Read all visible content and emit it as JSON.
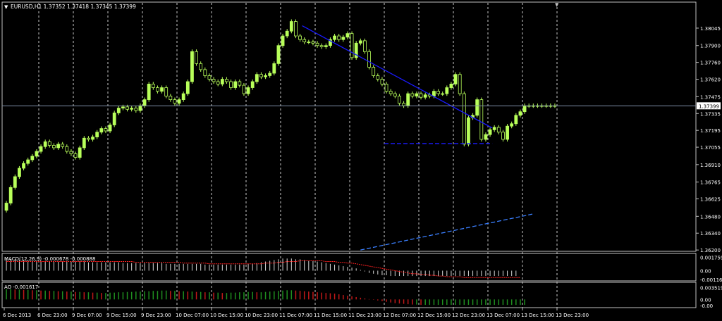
{
  "colors": {
    "background": "#000000",
    "frame": "#c0c0c0",
    "grid": "#c8c8c8",
    "text": "#ffffff",
    "candle_bull": "#b8ff5a",
    "candle_bear": "#000000",
    "candle_wick": "#b8ff5a",
    "trendline": "#1a1aff",
    "support": "#1a1aff",
    "channel": "#3a7fff",
    "bid_line": "#8090a8",
    "macd_hist": "#d8d8d8",
    "macd_signal": "#ff2020",
    "ao_up": "#1f8f1f",
    "ao_down": "#c01818"
  },
  "chart_data": [
    {
      "type": "candlestick",
      "title": "EURUSD,H1  1.37352 1.37418 1.37345 1.37399",
      "symbol_menu_icon": "triangle-down-icon",
      "ylim": [
        1.36195,
        1.38115
      ],
      "y_ticks": [
        "1.38045",
        "1.37900",
        "1.37760",
        "1.37620",
        "1.37475",
        "1.37335",
        "1.37195",
        "1.37055",
        "1.36910",
        "1.36765",
        "1.36625",
        "1.36480",
        "1.36340",
        "1.36200"
      ],
      "current_price_label": "1.37399",
      "current_price": 1.37399,
      "x_ticks": [
        "6 Dec 2013",
        "6 Dec 23:00",
        "9 Dec 07:00",
        "9 Dec 15:00",
        "9 Dec 23:00",
        "10 Dec 07:00",
        "10 Dec 15:00",
        "10 Dec 23:00",
        "11 Dec 07:00",
        "11 Dec 15:00",
        "11 Dec 23:00",
        "12 Dec 07:00",
        "12 Dec 15:00",
        "12 Dec 23:00",
        "13 Dec 07:00",
        "13 Dec 15:00",
        "13 Dec 23:00"
      ],
      "grid_x_ticks": [
        1,
        2,
        3,
        4,
        5,
        6,
        7,
        8,
        9,
        10,
        11,
        12,
        13,
        14,
        15,
        16
      ],
      "bars_per_tick": 8,
      "bar_count": 128,
      "close": [
        1.3659,
        1.3672,
        1.3681,
        1.3688,
        1.3692,
        1.3695,
        1.3698,
        1.3702,
        1.3706,
        1.371,
        1.3707,
        1.3705,
        1.3708,
        1.3706,
        1.3702,
        1.37,
        1.3697,
        1.3705,
        1.3713,
        1.3712,
        1.3714,
        1.3718,
        1.3721,
        1.3719,
        1.3724,
        1.3734,
        1.3738,
        1.3739,
        1.3737,
        1.3738,
        1.3736,
        1.374,
        1.3745,
        1.3758,
        1.3755,
        1.3752,
        1.3755,
        1.3748,
        1.3745,
        1.3742,
        1.3745,
        1.375,
        1.376,
        1.3785,
        1.3775,
        1.377,
        1.3765,
        1.3762,
        1.376,
        1.3758,
        1.3762,
        1.376,
        1.3755,
        1.376,
        1.3757,
        1.375,
        1.3755,
        1.376,
        1.3766,
        1.3764,
        1.3765,
        1.3767,
        1.3775,
        1.379,
        1.3798,
        1.3802,
        1.381,
        1.3798,
        1.3795,
        1.3793,
        1.3793,
        1.3792,
        1.379,
        1.3789,
        1.379,
        1.3795,
        1.3798,
        1.3795,
        1.3797,
        1.38,
        1.378,
        1.3792,
        1.3794,
        1.3785,
        1.3772,
        1.3765,
        1.3762,
        1.3758,
        1.3752,
        1.375,
        1.3748,
        1.3742,
        1.374,
        1.375,
        1.3748,
        1.375,
        1.3747,
        1.3749,
        1.3748,
        1.3752,
        1.375,
        1.375,
        1.3755,
        1.3758,
        1.3766,
        1.375,
        1.3708,
        1.373,
        1.3732,
        1.3745,
        1.3712,
        1.3716,
        1.372,
        1.3722,
        1.3718,
        1.3712,
        1.3723,
        1.3725,
        1.3732,
        1.3735,
        1.374,
        1.374,
        1.374,
        1.374,
        1.374,
        1.374,
        1.374,
        1.374
      ],
      "trendlines": [
        {
          "name": "resistance-trendline",
          "style": "solid",
          "color": "#1a1aff",
          "x": [
            68.5,
            112.5
          ],
          "y": [
            1.38065,
            1.37215
          ]
        },
        {
          "name": "support-line",
          "style": "dashed",
          "color": "#1a1aff",
          "x": [
            87.5,
            112.5
          ],
          "y": [
            1.37085,
            1.37085
          ]
        },
        {
          "name": "rising-channel-line",
          "style": "dashed",
          "color": "#3a7fff",
          "x": [
            82,
            122
          ],
          "y": [
            1.362,
            1.365
          ]
        }
      ]
    },
    {
      "type": "histogram",
      "title": "MACD(12,26,9) -0.000678 -0.000888",
      "y_ticks": [
        "0.001759",
        "0.00",
        "-0.00116"
      ],
      "ylim": [
        -0.00125,
        0.0019
      ],
      "hist": [
        0.0016,
        0.0015,
        0.0015,
        0.0014,
        0.0014,
        0.0014,
        0.0013,
        0.0013,
        0.0013,
        0.0013,
        0.0012,
        0.0012,
        0.0012,
        0.0012,
        0.0012,
        0.0012,
        0.0012,
        0.0012,
        0.0012,
        0.0011,
        0.0011,
        0.0011,
        0.0011,
        0.0011,
        0.0011,
        0.0011,
        0.0011,
        0.001,
        0.001,
        0.001,
        0.001,
        0.001,
        0.001,
        0.001,
        0.001,
        0.001,
        0.001,
        0.0009,
        0.0009,
        0.0009,
        0.0009,
        0.0009,
        0.0009,
        0.0009,
        0.0009,
        0.0009,
        0.0008,
        0.0008,
        0.0008,
        0.0008,
        0.0008,
        0.0008,
        0.0008,
        0.0008,
        0.0008,
        0.0008,
        0.0009,
        0.0009,
        0.001,
        0.0011,
        0.0012,
        0.0013,
        0.0014,
        0.0015,
        0.0016,
        0.0016,
        0.0016,
        0.0015,
        0.0015,
        0.0014,
        0.0013,
        0.0013,
        0.0012,
        0.0011,
        0.001,
        0.0009,
        0.0008,
        0.0007,
        0.0006,
        0.0005,
        0.0004,
        0.0003,
        0.0001,
        -0.0001,
        -0.0003,
        -0.0004,
        -0.0005,
        -0.0006,
        -0.0006,
        -0.0007,
        -0.0007,
        -0.0007,
        -0.0007,
        -0.0007,
        -0.0007,
        -0.0007,
        -0.0007,
        -0.0007,
        -0.0007,
        -0.0007,
        -0.0007,
        -0.0007,
        -0.0007,
        -0.0007,
        -0.0007,
        -0.0007,
        -0.0007,
        -0.0007,
        -0.0007,
        -0.0007,
        -0.0007,
        -0.0007,
        -0.0007,
        -0.0007,
        -0.0007,
        -0.0007,
        -0.0007,
        -0.0007,
        -0.0007
      ],
      "signal": [
        0.0012,
        0.0012,
        0.0012,
        0.0012,
        0.0012,
        0.0012,
        0.0012,
        0.0012,
        0.0012,
        0.0012,
        0.0012,
        0.0012,
        0.0012,
        0.0012,
        0.0012,
        0.0012,
        0.0012,
        0.0012,
        0.0012,
        0.0012,
        0.0012,
        0.0012,
        0.0012,
        0.0012,
        0.0012,
        0.0012,
        0.0012,
        0.0012,
        0.0012,
        0.0012,
        0.0011,
        0.0011,
        0.0011,
        0.0011,
        0.0011,
        0.0011,
        0.0011,
        0.0011,
        0.0011,
        0.0011,
        0.0011,
        0.001,
        0.001,
        0.001,
        0.001,
        0.001,
        0.001,
        0.0009,
        0.0009,
        0.0009,
        0.0009,
        0.0009,
        0.0009,
        0.0009,
        0.0009,
        0.0009,
        0.0009,
        0.0009,
        0.0009,
        0.0009,
        0.001,
        0.001,
        0.001,
        0.0011,
        0.0011,
        0.0012,
        0.0012,
        0.0012,
        0.0013,
        0.0013,
        0.0013,
        0.0013,
        0.0013,
        0.0013,
        0.0012,
        0.0012,
        0.0012,
        0.0011,
        0.0011,
        0.001,
        0.001,
        0.0009,
        0.0008,
        0.0007,
        0.0006,
        0.0005,
        0.0004,
        0.0003,
        0.0002,
        0.0001,
        0.0,
        -0.0001,
        -0.0002,
        -0.0003,
        -0.0004,
        -0.0004,
        -0.0005,
        -0.0005,
        -0.0006,
        -0.0006,
        -0.0007,
        -0.0007,
        -0.0008,
        -0.0008,
        -0.0008,
        -0.0008,
        -0.0009,
        -0.0009,
        -0.0009,
        -0.0009,
        -0.0009,
        -0.0009,
        -0.0009,
        -0.0009,
        -0.0009,
        -0.0009,
        -0.0009,
        -0.0009,
        -0.0009,
        -0.0009
      ]
    },
    {
      "type": "histogram",
      "title": "AO -0.001617",
      "y_ticks": [
        "0.003519",
        "0.00",
        "-0.00"
      ],
      "ylim": [
        -0.0022,
        0.0042
      ],
      "values": [
        0.003,
        0.003,
        0.0029,
        0.0029,
        0.0028,
        0.0028,
        0.0027,
        0.0027,
        0.0026,
        0.0026,
        0.0025,
        0.0025,
        0.0024,
        0.0024,
        0.0023,
        0.0023,
        0.0022,
        0.0022,
        0.0021,
        0.0021,
        0.002,
        0.002,
        0.0019,
        0.0019,
        0.002,
        0.002,
        0.0021,
        0.0021,
        0.0022,
        0.0022,
        0.0023,
        0.0023,
        0.0024,
        0.0024,
        0.0025,
        0.0025,
        0.0026,
        0.0026,
        0.0025,
        0.0025,
        0.0024,
        0.0024,
        0.0023,
        0.0023,
        0.0022,
        0.0022,
        0.0021,
        0.0021,
        0.002,
        0.002,
        0.0019,
        0.0019,
        0.002,
        0.002,
        0.0021,
        0.0021,
        0.0022,
        0.0022,
        0.0021,
        0.0021,
        0.0022,
        0.0023,
        0.0024,
        0.0025,
        0.0026,
        0.0027,
        0.0027,
        0.0026,
        0.0025,
        0.0024,
        0.0023,
        0.0022,
        0.0021,
        0.002,
        0.0019,
        0.0018,
        0.0017,
        0.0015,
        0.0013,
        0.0011,
        0.0009,
        0.0007,
        0.0005,
        0.0003,
        0.0001,
        -0.0001,
        -0.0003,
        -0.0005,
        -0.0007,
        -0.0009,
        -0.0011,
        -0.0012,
        -0.0013,
        -0.0014,
        -0.0015,
        -0.0015,
        -0.0016,
        -0.0016,
        -0.0016,
        -0.0016,
        -0.0016,
        -0.0016,
        -0.0016,
        -0.0016,
        -0.0016,
        -0.0016,
        -0.0016,
        -0.0016,
        -0.0016,
        -0.0016,
        -0.0016,
        -0.0016,
        -0.0016,
        -0.0016,
        -0.0016,
        -0.0016,
        -0.0016,
        -0.0016,
        -0.0016,
        -0.0016,
        -0.0016
      ]
    }
  ]
}
